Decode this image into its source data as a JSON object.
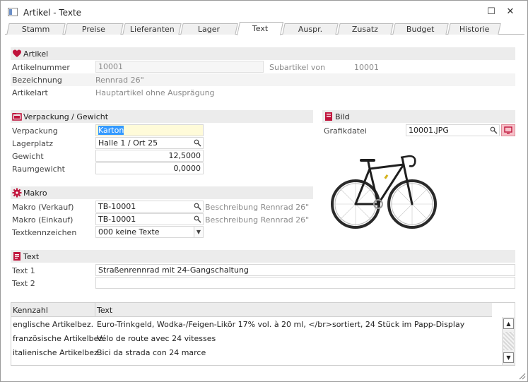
{
  "window": {
    "title": "Artikel - Texte",
    "maximize_glyph": "☐",
    "close_glyph": "✕"
  },
  "tabs": [
    {
      "label": "Stamm"
    },
    {
      "label": "Preise"
    },
    {
      "label": "Lieferanten"
    },
    {
      "label": "Lager"
    },
    {
      "label": "Text",
      "active": true
    },
    {
      "label": "Auspr."
    },
    {
      "label": "Zusatz"
    },
    {
      "label": "Budget"
    },
    {
      "label": "Historie"
    }
  ],
  "artikel": {
    "header": "Artikel",
    "artikelnummer_label": "Artikelnummer",
    "artikelnummer_value": "10001",
    "subartikel_label": "Subartikel von",
    "subartikel_value": "10001",
    "bezeichnung_label": "Bezeichnung",
    "bezeichnung_value": "Rennrad 26\"",
    "artikelart_label": "Artikelart",
    "artikelart_value": "Hauptartikel ohne Ausprägung"
  },
  "verpackung": {
    "header": "Verpackung / Gewicht",
    "verpackung_label": "Verpackung",
    "verpackung_value": "Karton",
    "lagerplatz_label": "Lagerplatz",
    "lagerplatz_value": "Halle 1 / Ort 25",
    "gewicht_label": "Gewicht",
    "gewicht_value": "12,5000",
    "raumgewicht_label": "Raumgewicht",
    "raumgewicht_value": "0,0000"
  },
  "bild": {
    "header": "Bild",
    "grafikdatei_label": "Grafikdatei",
    "grafikdatei_value": "10001.JPG"
  },
  "makro": {
    "header": "Makro",
    "verkauf_label": "Makro (Verkauf)",
    "verkauf_value": "TB-10001",
    "verkauf_desc": "Beschreibung Rennrad 26\"",
    "einkauf_label": "Makro (Einkauf)",
    "einkauf_value": "TB-10001",
    "einkauf_desc": "Beschreibung Rennrad 26\"",
    "textkennzeichen_label": "Textkennzeichen",
    "textkennzeichen_value": "000 keine Texte"
  },
  "text": {
    "header": "Text",
    "text1_label": "Text 1",
    "text1_value": "Straßenrennrad mit 24-Gangschaltung",
    "text2_label": "Text 2",
    "text2_value": ""
  },
  "grid": {
    "col_kennzahl": "Kennzahl",
    "col_text": "Text",
    "rows": [
      {
        "kennzahl": "englische Artikelbez.",
        "text": "Euro-Trinkgeld, Wodka-/Feigen-Likör 17% vol. à 20 ml,  </br>sortiert, 24 Stück im Papp-Display"
      },
      {
        "kennzahl": "französische Artikelbez.",
        "text": "Vélo de route avec 24 vitesses"
      },
      {
        "kennzahl": "italienische Artikelbez.",
        "text": "Bici da strada con 24 marce"
      }
    ]
  },
  "colors": {
    "section_bg": "#ececec",
    "icon_red": "#c0143c",
    "selection": "#3399ff",
    "highlight_yellow": "#fffbd9"
  },
  "icons": [
    "heart-icon",
    "folder-icon",
    "book-icon",
    "gear-icon",
    "document-icon",
    "magnifier-icon",
    "monitor-icon"
  ]
}
